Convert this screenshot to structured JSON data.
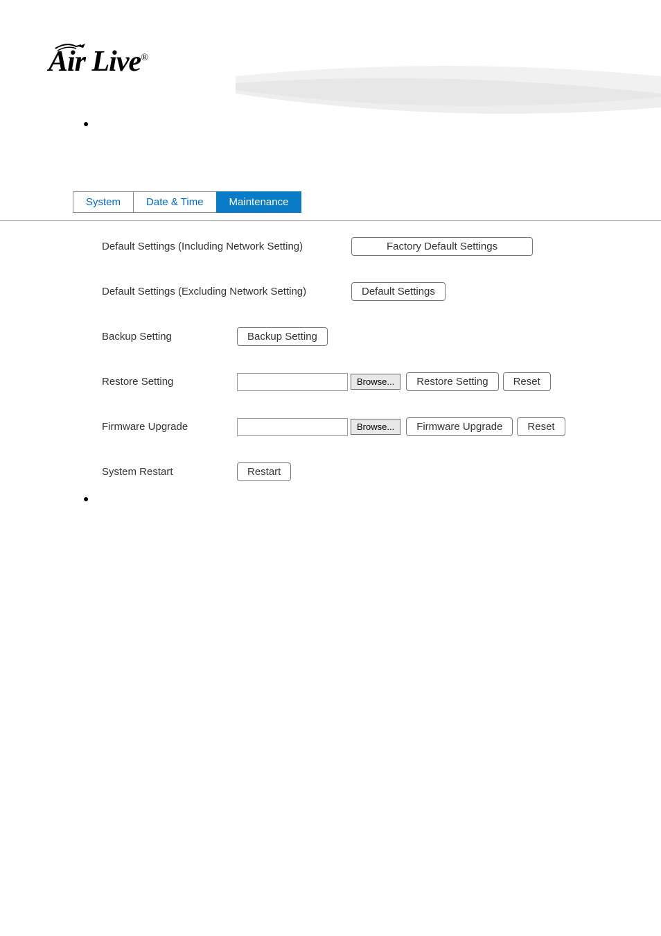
{
  "logo": {
    "text": "Air Live",
    "reg": "®"
  },
  "tabs": {
    "items": [
      {
        "label": "System"
      },
      {
        "label": "Date & Time"
      },
      {
        "label": "Maintenance"
      }
    ]
  },
  "form": {
    "row1": {
      "label": "Default Settings (Including Network Setting)",
      "button": "Factory Default Settings"
    },
    "row2": {
      "label": "Default Settings (Excluding Network Setting)",
      "button": "Default Settings"
    },
    "row3": {
      "label": "Backup Setting",
      "button": "Backup Setting"
    },
    "row4": {
      "label": "Restore Setting",
      "browse": "Browse...",
      "button": "Restore Setting",
      "reset": "Reset"
    },
    "row5": {
      "label": "Firmware Upgrade",
      "browse": "Browse...",
      "button": "Firmware Upgrade",
      "reset": "Reset"
    },
    "row6": {
      "label": "System Restart",
      "button": "Restart"
    }
  }
}
